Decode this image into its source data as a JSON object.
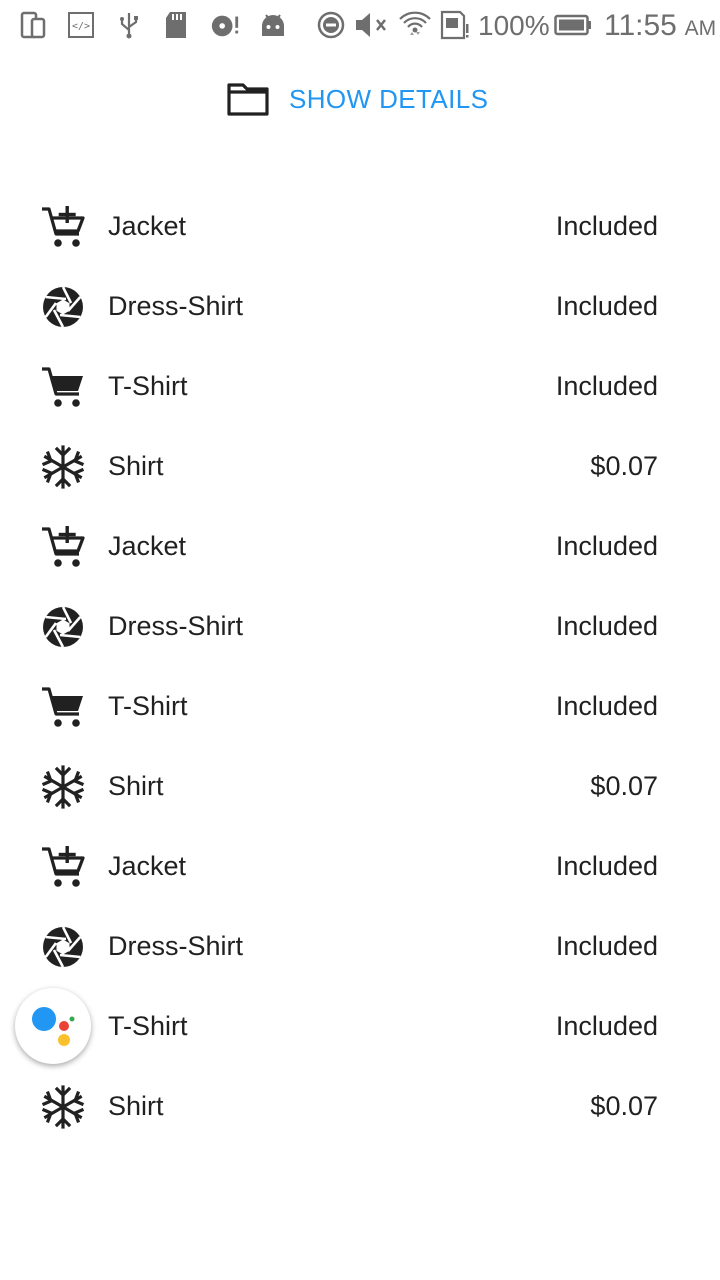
{
  "status_bar": {
    "battery_percent": "100%",
    "time": "11:55",
    "ampm": "AM",
    "icons": [
      "device-icon",
      "code-icon",
      "usb-icon",
      "sd-card-icon",
      "disc-alert-icon",
      "android-icon",
      "dnd-icon",
      "mute-icon",
      "wifi-icon",
      "sim-alert-icon",
      "battery-icon"
    ]
  },
  "header": {
    "show_details_label": "SHOW DETAILS",
    "icon": "folder-icon"
  },
  "items": [
    {
      "name": "Jacket",
      "price": "Included",
      "icon": "cart-plus-icon"
    },
    {
      "name": "Dress-Shirt",
      "price": "Included",
      "icon": "camera-aperture-icon"
    },
    {
      "name": "T-Shirt",
      "price": "Included",
      "icon": "cart-icon"
    },
    {
      "name": "Shirt",
      "price": "$0.07",
      "icon": "snowflake-icon"
    },
    {
      "name": "Jacket",
      "price": "Included",
      "icon": "cart-plus-icon"
    },
    {
      "name": "Dress-Shirt",
      "price": "Included",
      "icon": "camera-aperture-icon"
    },
    {
      "name": "T-Shirt",
      "price": "Included",
      "icon": "cart-icon"
    },
    {
      "name": "Shirt",
      "price": "$0.07",
      "icon": "snowflake-icon"
    },
    {
      "name": "Jacket",
      "price": "Included",
      "icon": "cart-plus-icon"
    },
    {
      "name": "Dress-Shirt",
      "price": "Included",
      "icon": "camera-aperture-icon"
    },
    {
      "name": "T-Shirt",
      "price": "Included",
      "icon": "cart-icon"
    },
    {
      "name": "Shirt",
      "price": "$0.07",
      "icon": "snowflake-icon"
    }
  ],
  "colors": {
    "accent": "#2196f3",
    "text": "#212121",
    "status": "#6e6e6e"
  }
}
